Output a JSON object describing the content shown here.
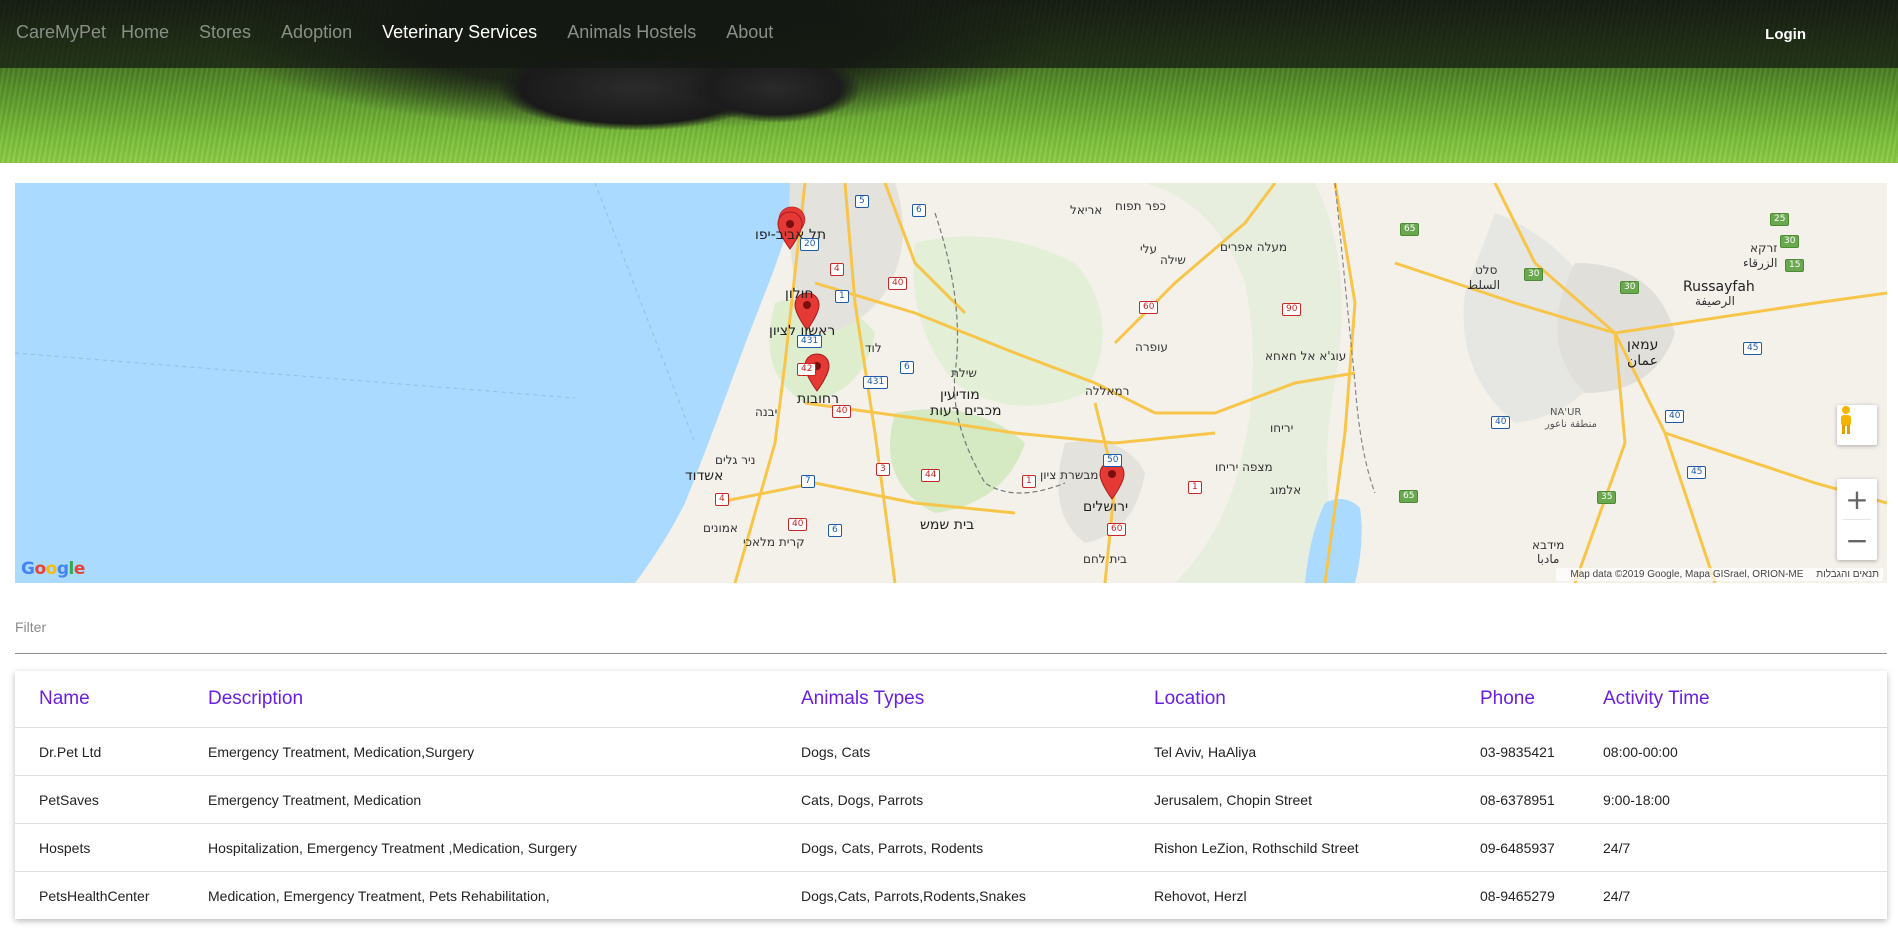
{
  "nav": {
    "brand": "CareMyPet",
    "links": [
      {
        "label": "Home",
        "active": false
      },
      {
        "label": "Stores",
        "active": false
      },
      {
        "label": "Adoption",
        "active": false
      },
      {
        "label": "Veterinary Services",
        "active": true
      },
      {
        "label": "Animals Hostels",
        "active": false
      },
      {
        "label": "About",
        "active": false
      }
    ],
    "login": "Login"
  },
  "map": {
    "labels": {
      "tel_aviv": "תל אביב-יפו",
      "holon": "חולון",
      "rishon": "ראשון לציון",
      "rehovot": "רחובות",
      "lod": "לוד",
      "modiin": "מודיעין",
      "makabim": "מכבים רעות",
      "yavne": "יבנה",
      "ashdod": "אשדוד",
      "beit_shemesh": "בית שמש",
      "jerusalem": "ירושלים",
      "beit_lehem": "בית לחם",
      "mevaseret": "מבשרת ציון",
      "kiryat_malachi": "קרית מלאכי",
      "ariel": "אריאל",
      "kfar_tapuah": "כפר תפוח",
      "eli": "עלי",
      "shilo": "שילה",
      "maale_efraim": "מעלה אפרים",
      "ofra": "עופרה",
      "ramallah": "רמאללה",
      "yeriho": "יריחו",
      "mitzpe_yeriho": "מצפה יריחו",
      "almog": "אלמוג",
      "salt_he": "סלט",
      "salt_ar": "السلط",
      "zarqa_he": "זרקא",
      "zarqa_ar": "الزرقاء",
      "russeifa_en": "Russayfah",
      "russeifa_ar": "الرصيفة",
      "amman_he": "עמאן",
      "amman_ar": "عمان",
      "naur_en": "NA'UR",
      "naur_ar": "منطقة ناعور",
      "madaba_he": "מידבא",
      "madaba_ar": "مادبا",
      "ein_alhachsa": "עוג'א אל חאחא",
      "ashkelon_ir": "אמונים",
      "nir_galim": "ניר גלים",
      "shilat": "שילת"
    },
    "road_numbers": [
      "5",
      "6",
      "20",
      "4",
      "1",
      "40",
      "431",
      "42",
      "6",
      "431",
      "40",
      "3",
      "44",
      "7",
      "4",
      "40",
      "6",
      "1",
      "50",
      "60",
      "1",
      "60",
      "90",
      "30",
      "30",
      "65",
      "25",
      "30",
      "15",
      "45",
      "40",
      "40",
      "45",
      "35",
      "65"
    ],
    "zoom_in": "+",
    "zoom_out": "−",
    "google": "Google",
    "attribution": "Map data ©2019 Google, Mapa GISrael, ORION-ME",
    "terms": "תנאים והגבלות",
    "colors": {
      "sea": "#aadaff",
      "land": "#f3f1ea",
      "marker": "#e53935",
      "road": "#f8c54b"
    }
  },
  "filter": {
    "placeholder": "Filter",
    "value": ""
  },
  "table": {
    "headers": [
      "Name",
      "Description",
      "Animals Types",
      "Location",
      "Phone",
      "Activity Time"
    ],
    "rows": [
      [
        "Dr.Pet Ltd",
        "Emergency Treatment, Medication,Surgery",
        "Dogs, Cats",
        "Tel Aviv, HaAliya",
        "03-9835421",
        "08:00-00:00"
      ],
      [
        "PetSaves",
        "Emergency Treatment, Medication",
        "Cats, Dogs, Parrots",
        "Jerusalem, Chopin Street",
        "08-6378951",
        "9:00-18:00"
      ],
      [
        "Hospets",
        "Hospitalization, Emergency Treatment ,Medication, Surgery",
        "Dogs, Cats, Parrots, Rodents",
        "Rishon LeZion, Rothschild Street",
        "09-6485937",
        "24/7"
      ],
      [
        "PetsHealthCenter",
        "Medication, Emergency Treatment, Pets Rehabilitation,",
        "Dogs,Cats, Parrots,Rodents,Snakes",
        "Rehovot, Herzl",
        "08-9465279",
        "24/7"
      ]
    ],
    "header_color": "#6a1fe0"
  }
}
